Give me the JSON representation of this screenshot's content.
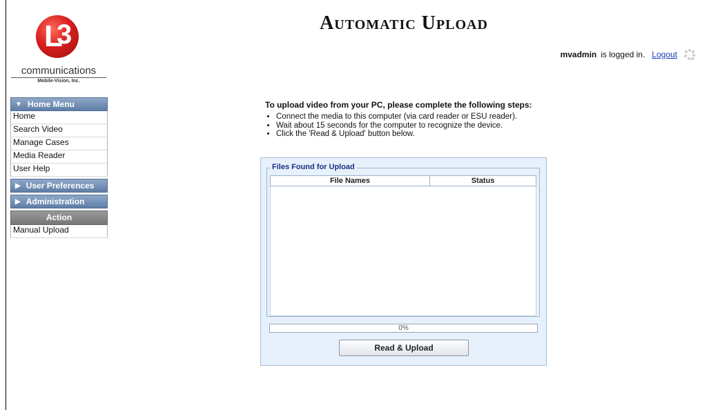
{
  "logo": {
    "company": "communications",
    "subtitle": "Mobile-Vision, Inc."
  },
  "header": {
    "title": "Automatic Upload"
  },
  "login": {
    "username": "mvadmin",
    "suffix": "is logged in.",
    "logout_label": "Logout"
  },
  "sidebar": {
    "home_menu": {
      "label": "Home Menu",
      "expanded": true
    },
    "items": [
      {
        "label": "Home"
      },
      {
        "label": "Search Video"
      },
      {
        "label": "Manage Cases"
      },
      {
        "label": "Media Reader"
      },
      {
        "label": "User Help"
      }
    ],
    "user_preferences": {
      "label": "User Preferences"
    },
    "administration": {
      "label": "Administration"
    },
    "action": {
      "label": "Action",
      "items": [
        {
          "label": "Manual Upload"
        }
      ]
    }
  },
  "instructions": {
    "heading": "To upload video from your PC, please complete the following steps:",
    "steps": [
      "Connect the media to this computer (via card reader or ESU reader).",
      "Wait about 15 seconds for the computer to recognize the device.",
      "Click the 'Read & Upload' button below."
    ]
  },
  "upload_panel": {
    "legend": "Files Found for Upload",
    "columns": [
      "File Names",
      "Status"
    ],
    "rows": [],
    "progress": {
      "value": 0,
      "label": "0%"
    },
    "button_label": "Read & Upload"
  },
  "colors": {
    "menu_header": "#6f8cb3",
    "panel_bg": "#e6f1fb",
    "legend_text": "#1b2f84",
    "link": "#1a3ab5",
    "logo_red": "#d81f1f"
  }
}
